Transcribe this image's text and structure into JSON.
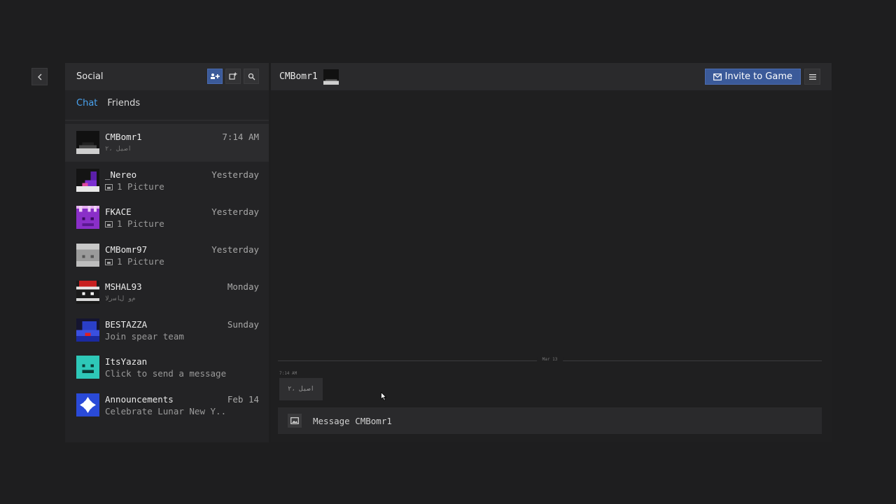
{
  "social": {
    "title": "Social",
    "tabs": [
      {
        "label": "Chat",
        "active": true
      },
      {
        "label": "Friends",
        "active": false
      }
    ]
  },
  "conversations": [
    {
      "name": "CMBomr1",
      "time": "7:14 AM",
      "preview": "ﺍﺻﻴﻞ ،٢",
      "preview_faint": true,
      "picture": false,
      "selected": true,
      "avatar": "hooded-dark"
    },
    {
      "name": "_Nereo",
      "time": "Yesterday",
      "preview": "1 Picture",
      "preview_faint": false,
      "picture": true,
      "selected": false,
      "avatar": "purple-dark"
    },
    {
      "name": "FKACE",
      "time": "Yesterday",
      "preview": "1 Picture",
      "preview_faint": false,
      "picture": true,
      "selected": false,
      "avatar": "purple-crown"
    },
    {
      "name": "CMBomr97",
      "time": "Yesterday",
      "preview": "1 Picture",
      "preview_faint": false,
      "picture": true,
      "selected": false,
      "avatar": "grey"
    },
    {
      "name": "MSHAL93",
      "time": "Monday",
      "preview": "ﻡﻭ ﻝﺎﺳﺭﻻ",
      "preview_faint": true,
      "picture": false,
      "selected": false,
      "avatar": "red-cap"
    },
    {
      "name": "BESTAZZA",
      "time": "Sunday",
      "preview": "Join spear team",
      "preview_faint": false,
      "picture": false,
      "selected": false,
      "avatar": "blue"
    },
    {
      "name": "ItsYazan",
      "time": "",
      "preview": "Click to send a message!",
      "preview_faint": false,
      "picture": false,
      "selected": false,
      "avatar": "teal-smile"
    },
    {
      "name": "Announcements",
      "time": "Feb 14",
      "preview": "Celebrate Lunar New Y...",
      "preview_faint": false,
      "picture": false,
      "selected": false,
      "avatar": "lunar-logo"
    }
  ],
  "chat": {
    "username": "CMBomr1",
    "invite_label": "Invite to Game",
    "date_separator": "Mar 13",
    "messages": [
      {
        "time": "7:14 AM",
        "text": "ﺍﺻﻴﻞ ،٢"
      }
    ],
    "composer_placeholder": "Message CMBomr1"
  },
  "colors": {
    "accent": "#3b5a99",
    "active_tab": "#4aa3f0"
  }
}
